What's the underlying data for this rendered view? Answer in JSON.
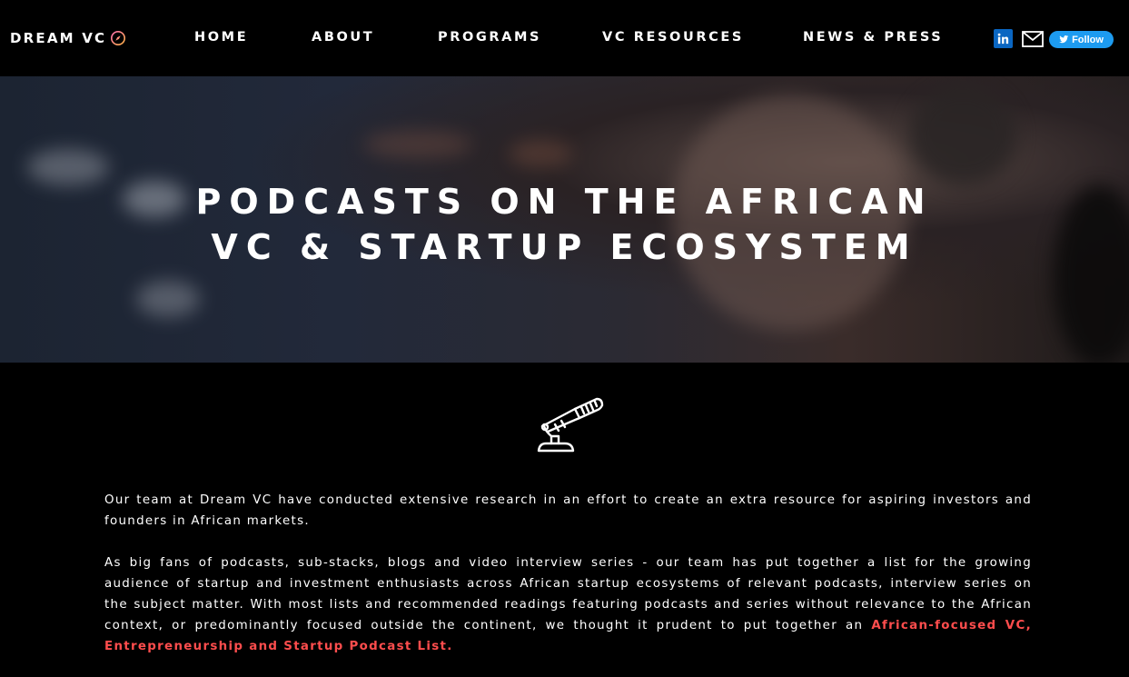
{
  "header": {
    "logo_text": "DREAM VC",
    "nav": [
      "HOME",
      "ABOUT",
      "PROGRAMS",
      "VC RESOURCES",
      "NEWS & PRESS"
    ],
    "social": {
      "linkedin_icon": "linkedin-icon",
      "mail_icon": "mail-icon",
      "follow_label": "Follow"
    }
  },
  "hero": {
    "title_line1": "PODCASTS ON THE AFRICAN",
    "title_line2": "VC & STARTUP ECOSYSTEM"
  },
  "content": {
    "icon": "microphone-icon",
    "paragraph1": "Our team at Dream VC have conducted extensive research in an effort to create an extra resource for aspiring investors and founders in African markets.",
    "paragraph2_text": "As big fans of podcasts, sub-stacks, blogs and video interview series - our team has put together a list for the growing audience of startup and investment enthusiasts across African startup ecosystems of relevant podcasts, interview series on the subject matter. With most lists and recommended readings featuring podcasts and series without relevance to the African context, or predominantly focused outside the continent, we thought it prudent to put together an ",
    "paragraph2_highlight": "African-focused VC, Entrepreneurship and Startup Podcast List."
  },
  "colors": {
    "background": "#000000",
    "highlight": "#ff4d4d",
    "linkedin": "#0a66c2",
    "twitter": "#1d9bf0"
  }
}
